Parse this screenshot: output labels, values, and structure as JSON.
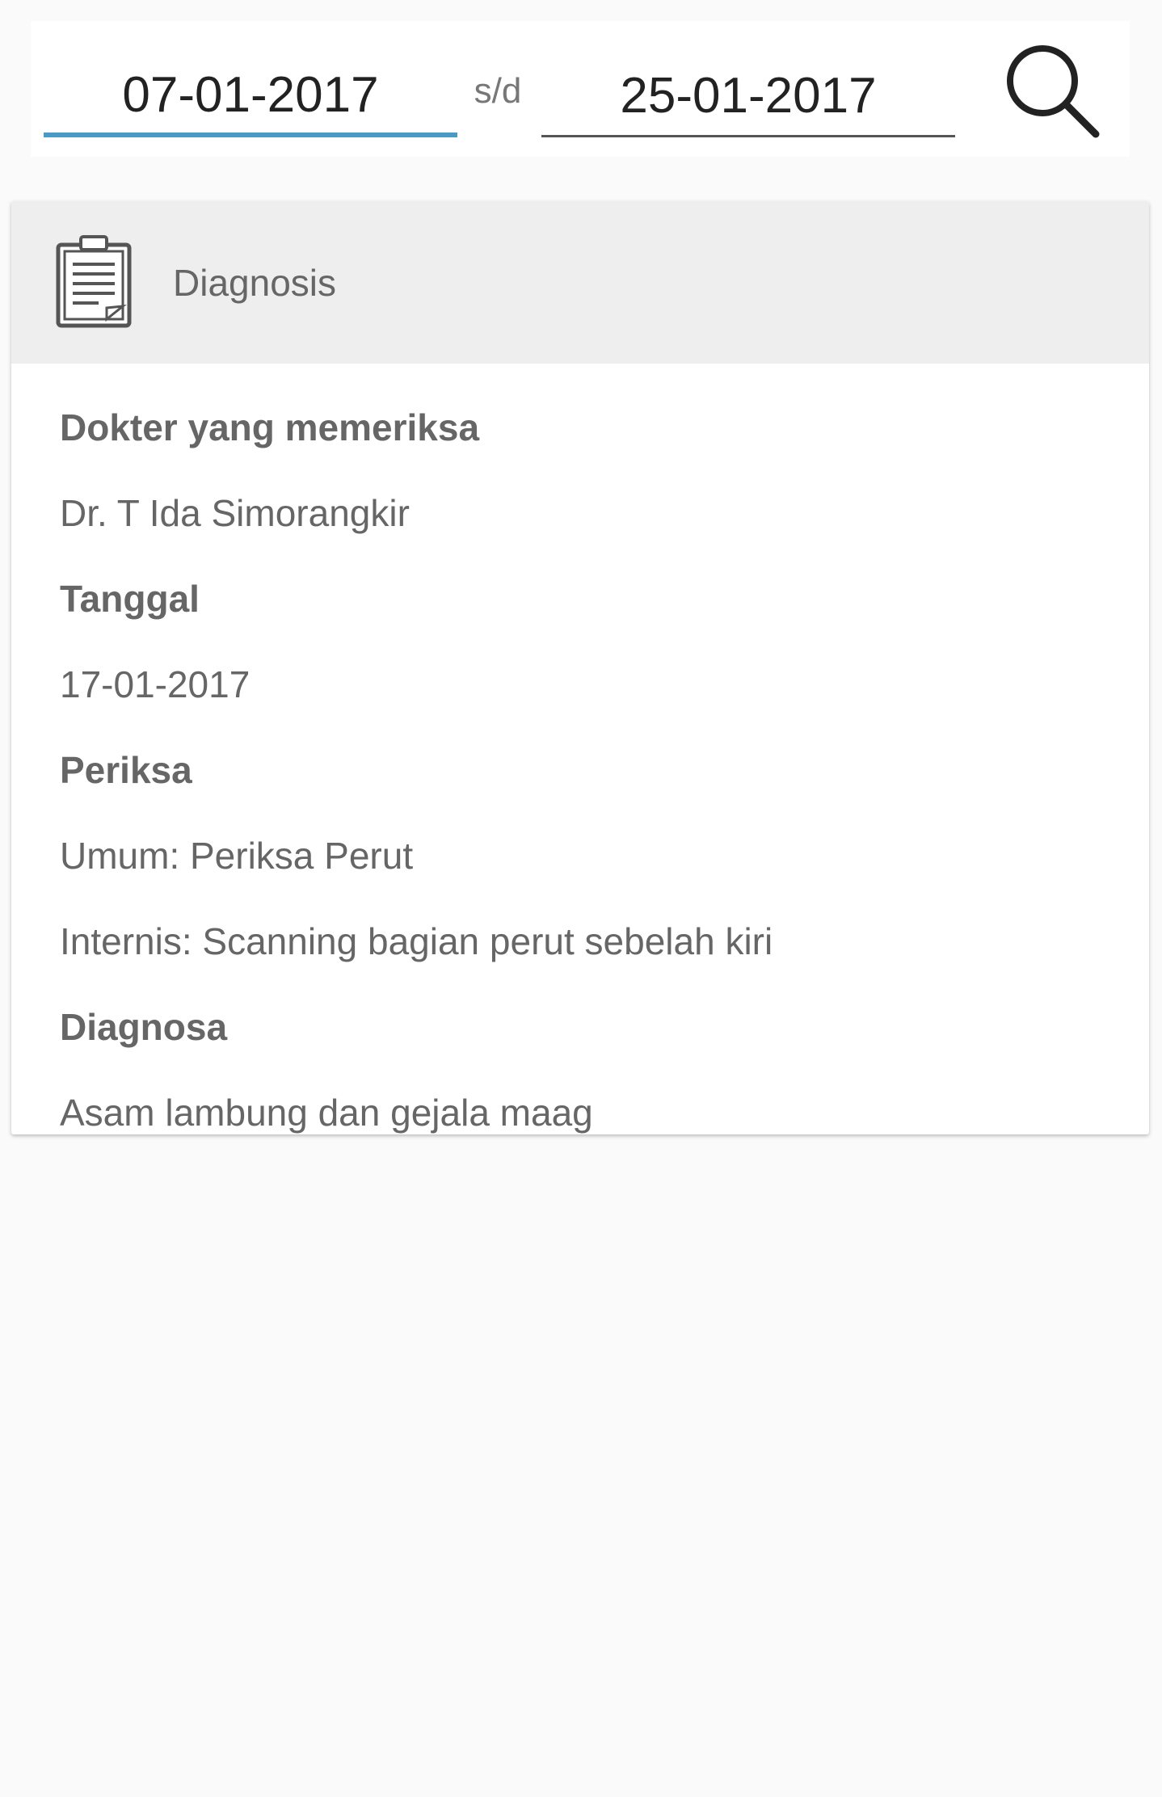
{
  "filter": {
    "date_from": "07-01-2017",
    "separator": "s/d",
    "date_to": "25-01-2017",
    "search_icon": "search-icon"
  },
  "card": {
    "icon": "clipboard-icon",
    "title": "Diagnosis",
    "doctor_label": "Dokter yang memeriksa",
    "doctor_value": "Dr. T Ida Simorangkir",
    "date_label": "Tanggal",
    "date_value": "17-01-2017",
    "exam_label": "Periksa",
    "exam_items": [
      "Umum: Periksa Perut",
      "Internis: Scanning bagian perut sebelah kiri"
    ],
    "diagnosis_label": "Diagnosa",
    "diagnosis_value": "Asam lambung dan gejala maag"
  },
  "colors": {
    "background": "#fafafa",
    "active_underline": "#4a9ac7",
    "header_bg": "#eeeeee",
    "text": "#666666"
  }
}
